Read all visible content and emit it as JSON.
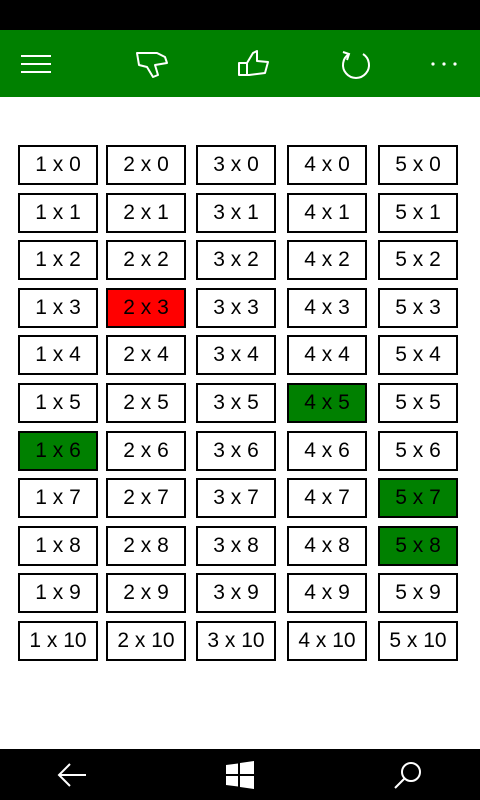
{
  "colors": {
    "accent": "#008000",
    "correct": "#008000",
    "wrong": "#ff0000",
    "cell_border": "#000000",
    "cell_background": "#ffffff",
    "system_bar": "#000000"
  },
  "app_bar": {
    "buttons": [
      {
        "name": "menu-icon"
      },
      {
        "name": "thumbs-down-icon"
      },
      {
        "name": "thumbs-up-icon"
      },
      {
        "name": "refresh-icon"
      },
      {
        "name": "more-icon"
      }
    ]
  },
  "grid": {
    "columns": [
      [
        "1 x 0",
        "1 x 1",
        "1 x 2",
        "1 x 3",
        "1 x 4",
        "1 x 5",
        "1 x 6",
        "1 x 7",
        "1 x 8",
        "1 x 9",
        "1 x 10"
      ],
      [
        "2 x 0",
        "2 x 1",
        "2 x 2",
        "2 x 3",
        "2 x 4",
        "2 x 5",
        "2 x 6",
        "2 x 7",
        "2 x 8",
        "2 x 9",
        "2 x 10"
      ],
      [
        "3 x 0",
        "3 x 1",
        "3 x 2",
        "3 x 3",
        "3 x 4",
        "3 x 5",
        "3 x 6",
        "3 x 7",
        "3 x 8",
        "3 x 9",
        "3 x 10"
      ],
      [
        "4 x 0",
        "4 x 1",
        "4 x 2",
        "4 x 3",
        "4 x 4",
        "4 x 5",
        "4 x 6",
        "4 x 7",
        "4 x 8",
        "4 x 9",
        "4 x 10"
      ],
      [
        "5 x 0",
        "5 x 1",
        "5 x 2",
        "5 x 3",
        "5 x 4",
        "5 x 5",
        "5 x 6",
        "5 x 7",
        "5 x 8",
        "5 x 9",
        "5 x 10"
      ]
    ],
    "states": {
      "2 x 3": "wrong",
      "4 x 5": "correct",
      "1 x 6": "correct",
      "5 x 7": "correct",
      "5 x 8": "correct"
    }
  },
  "nav_bar": {
    "buttons": [
      {
        "name": "back-arrow-icon"
      },
      {
        "name": "windows-start-icon"
      },
      {
        "name": "search-icon"
      }
    ]
  }
}
